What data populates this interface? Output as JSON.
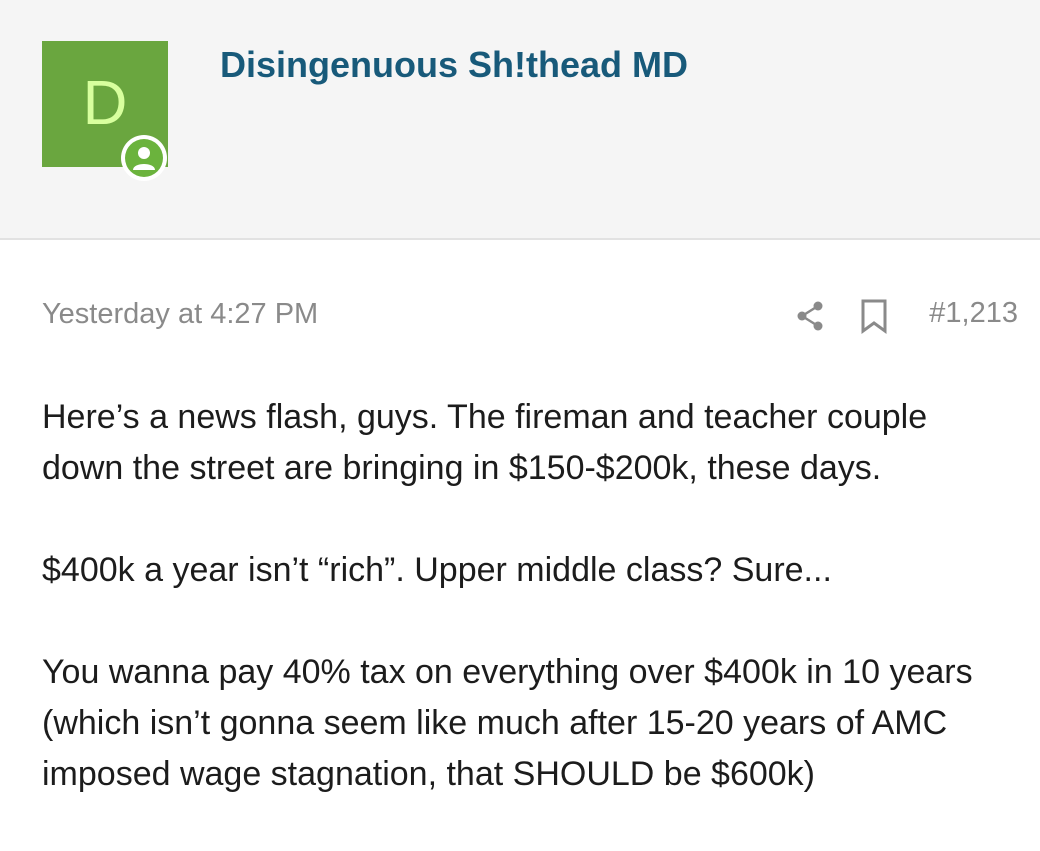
{
  "author": {
    "avatar_letter": "D",
    "name": "Disingenuous Sh!thead MD",
    "avatar_color": "#6aa63f",
    "avatar_letter_color": "#d8ff9e",
    "badge_icon": "user-circle-icon"
  },
  "meta": {
    "timestamp": "Yesterday at 4:27 PM",
    "share_icon": "share-icon",
    "bookmark_icon": "bookmark-icon",
    "post_number": "#1,213"
  },
  "body": {
    "paragraphs": [
      "Here’s a news flash, guys. The fireman and teacher couple down the street are bringing in $150-$200k, these days.",
      "$400k a year isn’t “rich”. Upper middle class? Sure...",
      "You wanna pay 40% tax on everything over $400k in 10 years (which isn’t gonna seem like much after 15-20 years of AMC imposed wage stagnation, that SHOULD be $600k)"
    ]
  },
  "colors": {
    "header_bg": "#f5f5f5",
    "username": "#185a7a",
    "muted_text": "#8a8a8a",
    "body_text": "#1c1c1c",
    "badge_green": "#6bb33d"
  }
}
